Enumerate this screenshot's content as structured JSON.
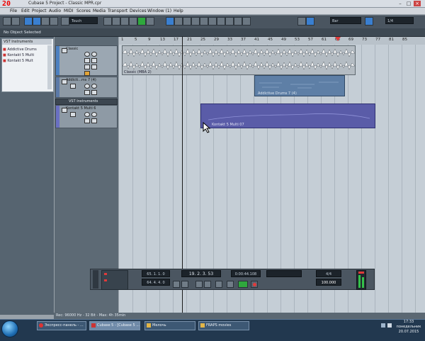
{
  "overlay": {
    "fps": "20"
  },
  "window": {
    "title": "Cubase 5 Project - Classic MPR.cpr"
  },
  "menu": [
    "File",
    "Edit",
    "Project",
    "Audio",
    "MIDI",
    "Scores",
    "Media",
    "Transport",
    "Devices",
    "Window (1)",
    "Help"
  ],
  "toolbar": {
    "automation_mode": "Touch",
    "snap_type": "Bar",
    "quantize": "1/4"
  },
  "info_line": {
    "text": "No Object Selected"
  },
  "inspector": {
    "header": "VST Instruments",
    "items": [
      "Addictive Drums",
      "Kontakt 5 Multi",
      "Kontakt 5 Mult"
    ]
  },
  "tracks": [
    {
      "name": "Classic",
      "color": "#4d80c0"
    },
    {
      "name": "Addicti...ms 7 (4)",
      "color": "#5c7aa8"
    },
    {
      "name": "VST Instruments",
      "color": "#3c4650"
    },
    {
      "name": "Kontakt 5 Multi 6",
      "color": "#6a70c2"
    }
  ],
  "ruler": {
    "labels": [
      "1",
      "5",
      "9",
      "13",
      "17",
      "21",
      "25",
      "29",
      "33",
      "37",
      "41",
      "45",
      "49",
      "53",
      "57",
      "61",
      "65",
      "69",
      "73",
      "77",
      "81",
      "85"
    ]
  },
  "events": {
    "audio": "Classic (MBA 2)",
    "drums": "Addictive Drums 7 (4)",
    "kontakt": "Kontakt 5 Multi 07"
  },
  "transport": {
    "left_locator": "65. 1. 1. 0",
    "right_locator": "64. 4. 4. 0",
    "position_bars": "19. 2. 3. 53",
    "position_time": "0:00:44.108",
    "tempo": "100.000",
    "signature": "4/4"
  },
  "status": {
    "text": "Rec: 96000 Hz - 32 Bit - Max: 4h 35min"
  },
  "taskbar": {
    "tasks": [
      "Экспресс-панель - ...",
      "Cubase 5 - [Cubase 5 ...",
      "Мелочь",
      "FRAPS movies"
    ],
    "clock_time": "17:33",
    "clock_day": "понедельник",
    "clock_date": "20.07.2015"
  },
  "colors": {
    "accent": "#3a7fd0",
    "play": "#2fa83d",
    "record": "#e03a3a"
  }
}
